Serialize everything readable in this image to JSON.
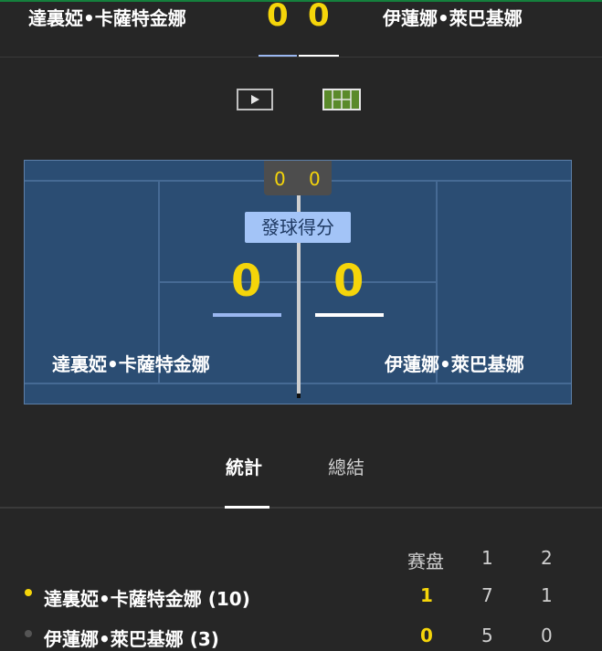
{
  "header": {
    "player1_name": "達裏婭•卡薩特金娜",
    "player2_name": "伊蓮娜•萊巴基娜",
    "player1_points": "0",
    "player2_points": "0"
  },
  "view_toggle": {
    "video_icon": "play-video-icon",
    "court_icon": "court-view-icon"
  },
  "court": {
    "games_player1": "0",
    "games_player2": "0",
    "serve_label": "發球得分",
    "points_player1": "0",
    "points_player2": "0",
    "player1_name": "達裏婭•卡薩特金娜",
    "player2_name": "伊蓮娜•萊巴基娜",
    "colors": {
      "court": "#2b4d73",
      "lines": "#466a94",
      "score": "#f5d50a",
      "player1_accent": "#9ab7f0",
      "player2_accent": "#ffffff"
    }
  },
  "tabs": [
    {
      "label": "統計",
      "active": true
    },
    {
      "label": "總結",
      "active": false
    }
  ],
  "scoreboard": {
    "columns": [
      "赛盘",
      "1",
      "2"
    ],
    "rows": [
      {
        "name": "達裏婭•卡薩特金娜 (10)",
        "serving": true,
        "sets": "1",
        "set1": "7",
        "set2": "1"
      },
      {
        "name": "伊蓮娜•萊巴基娜 (3)",
        "serving": false,
        "sets": "0",
        "set1": "5",
        "set2": "0"
      }
    ]
  }
}
